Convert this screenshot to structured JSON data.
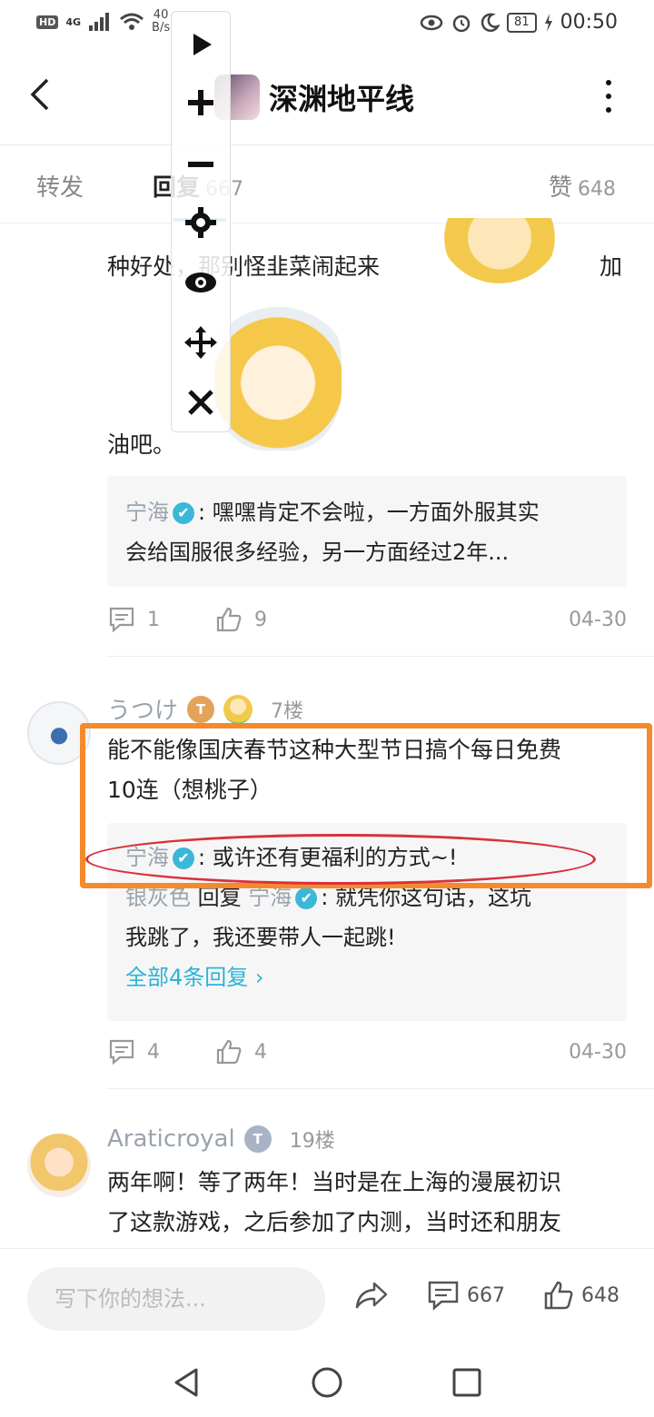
{
  "status_bar": {
    "left": {
      "hd": "HD",
      "network": "4G",
      "speed_value": "40",
      "speed_unit": "B/s"
    },
    "battery": "81",
    "time": "00:50"
  },
  "header": {
    "title": "深渊地平线"
  },
  "tabs": [
    {
      "label": "转发"
    },
    {
      "label": "回复",
      "count": "667"
    },
    {
      "label": "赞",
      "count": "648"
    }
  ],
  "comment_prev": {
    "text_line1": "种好处，那别怪韭菜闹起来",
    "text_line1_end": "加",
    "text_line2": "油吧。",
    "reply": {
      "name": "宁海",
      "line1": ": 嘿嘿肯定不会啦，一方面外服其实",
      "line2": "会给国服很多经验，另一方面经过2年..."
    },
    "comments": "1",
    "likes": "9",
    "date": "04-30"
  },
  "comment_7": {
    "username": "うつけ",
    "level": "T",
    "floor": "7楼",
    "text_line1": "能不能像国庆春节这种大型节日搞个每日免费",
    "text_line2": "10连（想桃子）",
    "reply1": {
      "name": "宁海",
      "text": ": 或许还有更福利的方式~!"
    },
    "reply2": {
      "name": "银灰色",
      "verb": "回复",
      "target": "宁海",
      "line1": ": 就凭你这句话，这坑",
      "line2": "我跳了，我还要带人一起跳!"
    },
    "all_replies": "全部4条回复",
    "comments": "4",
    "likes": "4",
    "date": "04-30"
  },
  "comment_19": {
    "username": "Araticroyal",
    "level": "T",
    "floor": "19楼",
    "text_line1": "两年啊！等了两年！当时是在上海的漫展初识",
    "text_line2": "了这款游戏，之后参加了内测，当时还和朋友"
  },
  "bottom_bar": {
    "placeholder": "写下你的想法...",
    "comment_count": "667",
    "like_count": "648"
  },
  "colors": {
    "accent": "#2ab4d6",
    "highlight_box": "#f58a2c",
    "highlight_ellipse": "#d8323c"
  }
}
